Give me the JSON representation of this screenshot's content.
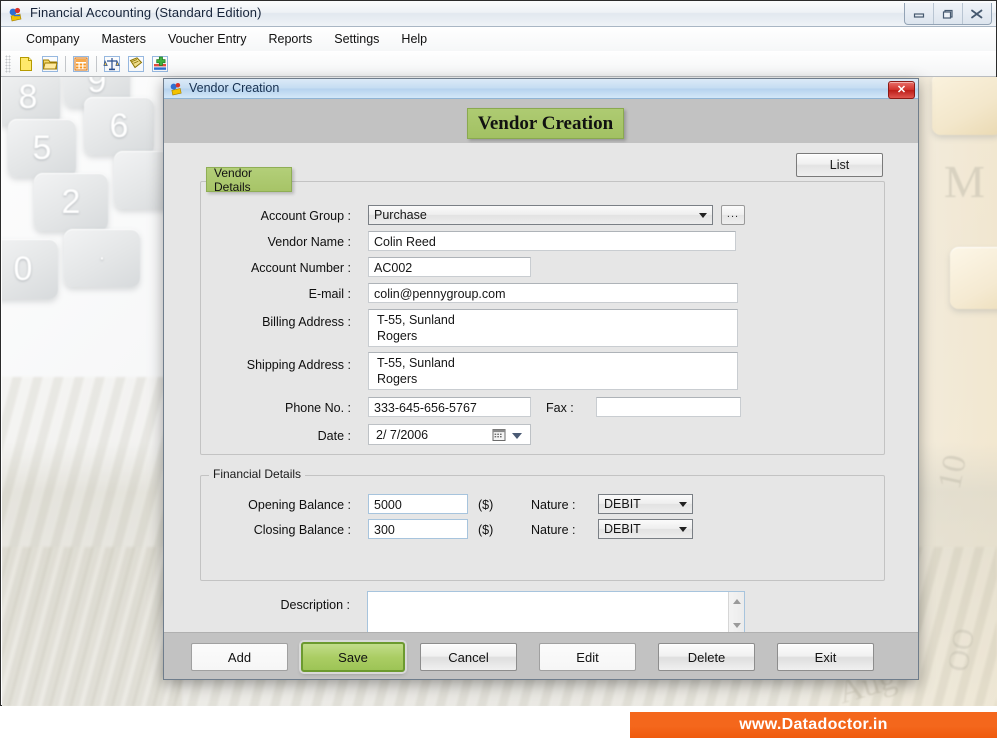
{
  "app": {
    "title": "Financial Accounting (Standard Edition)",
    "icon": "app-icon",
    "window_controls": [
      {
        "name": "minimize-button",
        "glyph": "minimize-icon"
      },
      {
        "name": "restore-button",
        "glyph": "restore-icon"
      },
      {
        "name": "close-button",
        "glyph": "close-icon"
      }
    ],
    "menubar": [
      {
        "label": "Company"
      },
      {
        "label": "Masters"
      },
      {
        "label": "Voucher Entry"
      },
      {
        "label": "Reports"
      },
      {
        "label": "Settings"
      },
      {
        "label": "Help"
      }
    ],
    "toolbar": [
      {
        "name": "new-document-icon"
      },
      {
        "name": "open-folder-icon"
      },
      {
        "name": "calculator-icon"
      },
      {
        "name": "balance-scales-icon"
      },
      {
        "name": "ledger-book-icon"
      },
      {
        "name": "add-record-icon"
      }
    ]
  },
  "dialog": {
    "title": "Vendor Creation",
    "close_label": "✕",
    "heading": "Vendor Creation",
    "list_button": "List",
    "vendor_group": {
      "legend": "Vendor Details",
      "fields": {
        "account_group_label": "Account Group :",
        "account_group_value": "Purchase",
        "browse_button": "...",
        "vendor_name_label": "Vendor Name :",
        "vendor_name_value": "Colin Reed",
        "account_number_label": "Account Number :",
        "account_number_value": "AC002",
        "email_label": "E-mail :",
        "email_value": "colin@pennygroup.com",
        "billing_address_label": "Billing Address :",
        "billing_address_value": "T-55, Sunland\nRogers",
        "shipping_address_label": "Shipping Address :",
        "shipping_address_value": "T-55, Sunland\nRogers",
        "phone_label": "Phone No. :",
        "phone_value": "333-645-656-5767",
        "fax_label": "Fax :",
        "fax_value": "",
        "date_label": "Date :",
        "date_value": "2/  7/2006"
      }
    },
    "financial_group": {
      "legend": "Financial Details",
      "fields": {
        "opening_balance_label": "Opening Balance :",
        "opening_balance_value": "5000",
        "opening_unit": "($)",
        "opening_nature_label": "Nature :",
        "opening_nature_value": "DEBIT",
        "closing_balance_label": "Closing Balance :",
        "closing_balance_value": "300",
        "closing_unit": "($)",
        "closing_nature_label": "Nature :",
        "closing_nature_value": "DEBIT"
      }
    },
    "description_label": "Description :",
    "description_value": "",
    "buttons": [
      {
        "label": "Add",
        "name": "add-button",
        "style": "flat"
      },
      {
        "label": "Save",
        "name": "save-button",
        "style": "save"
      },
      {
        "label": "Cancel",
        "name": "cancel-button",
        "style": "glossy"
      },
      {
        "label": "Edit",
        "name": "edit-button",
        "style": "flat"
      },
      {
        "label": "Delete",
        "name": "delete-button",
        "style": "glossy"
      },
      {
        "label": "Exit",
        "name": "exit-button",
        "style": "glossy"
      }
    ]
  },
  "background": {
    "keypad_digits": [
      "8",
      "9",
      "5",
      "6",
      "2",
      "0",
      "."
    ]
  },
  "footer": {
    "website": "www.Datadoctor.in",
    "accent_color": "#f4671c"
  }
}
